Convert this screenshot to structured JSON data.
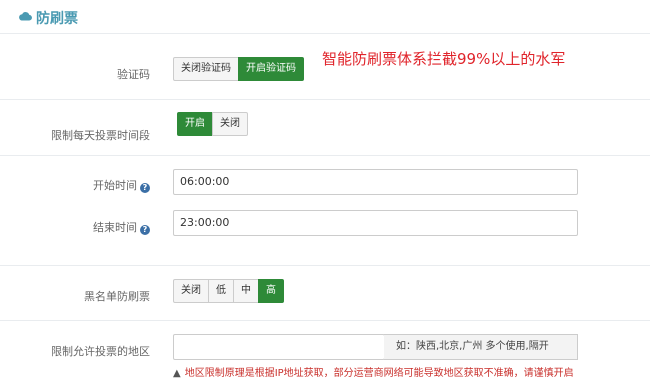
{
  "header": {
    "title": "防刷票",
    "icon": "cloud-icon"
  },
  "annotation": "智能防刷票体系拦截99%以上的水军",
  "captcha": {
    "label": "验证码",
    "options": [
      "关闭验证码",
      "开启验证码"
    ],
    "selected": "开启验证码"
  },
  "daily_limit": {
    "label": "限制每天投票时间段",
    "options": [
      "开启",
      "关闭"
    ],
    "selected": "开启"
  },
  "start_time": {
    "label": "开始时间",
    "value": "06:00:00",
    "help_icon": "help-icon"
  },
  "end_time": {
    "label": "结束时间",
    "value": "23:00:00",
    "help_icon": "help-icon"
  },
  "blacklist": {
    "label": "黑名单防刷票",
    "options": [
      "关闭",
      "低",
      "中",
      "高"
    ],
    "selected": "高"
  },
  "region": {
    "label": "限制允许投票的地区",
    "value": "",
    "addon": "如：陕西,北京,广州 多个使用,隔开",
    "warning": "地区限制原理是根据IP地址获取，部分运营商网络可能导致地区获取不准确，请谨慎开启"
  },
  "colors": {
    "accent": "#2e8a38",
    "title": "#4a9ab2",
    "annotation": "#e0242b",
    "warning": "#c9302c"
  }
}
